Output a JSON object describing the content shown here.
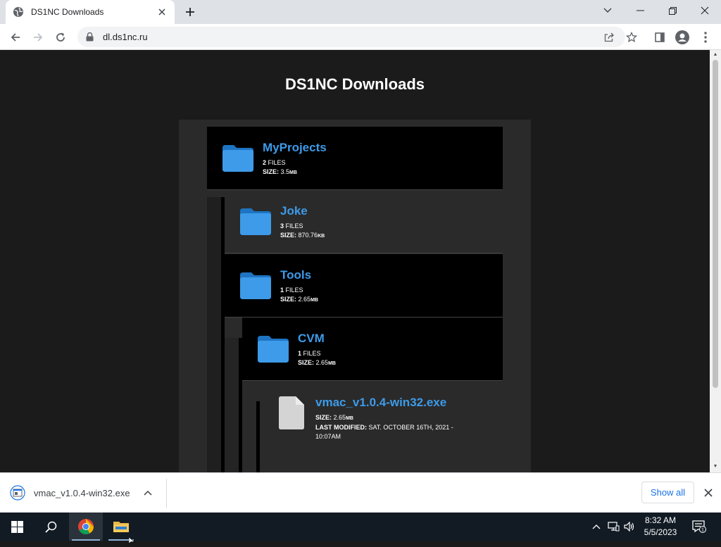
{
  "browser": {
    "tab_title": "DS1NC Downloads",
    "url": "dl.ds1nc.ru"
  },
  "page": {
    "heading": "DS1NC Downloads",
    "items": [
      {
        "type": "folder",
        "name": "MyProjects",
        "count": "2",
        "count_label": "FILES",
        "size_label": "SIZE:",
        "size_value": "3.5",
        "size_unit": "MB"
      },
      {
        "type": "folder",
        "name": "Joke",
        "count": "3",
        "count_label": "FILES",
        "size_label": "SIZE:",
        "size_value": "870.76",
        "size_unit": "KB"
      },
      {
        "type": "folder",
        "name": "Tools",
        "count": "1",
        "count_label": "FILES",
        "size_label": "SIZE:",
        "size_value": "2.65",
        "size_unit": "MB"
      },
      {
        "type": "folder",
        "name": "CVM",
        "count": "1",
        "count_label": "FILES",
        "size_label": "SIZE:",
        "size_value": "2.65",
        "size_unit": "MB"
      },
      {
        "type": "file",
        "name": "vmac_v1.0.4-win32.exe",
        "size_label": "SIZE:",
        "size_value": "2.65",
        "size_unit": "MB",
        "modified_label": "LAST MODIFIED:",
        "modified_value": "SAT. OCTOBER 16TH, 2021 -",
        "modified_value2": "10:07AM"
      }
    ]
  },
  "downloads": {
    "file_name": "vmac_v1.0.4-win32.exe",
    "show_all": "Show all"
  },
  "taskbar": {
    "time": "8:32 AM",
    "date": "5/5/2023",
    "notifications": "1"
  },
  "colors": {
    "link": "#3d9be9",
    "folder": "#2f8fe0",
    "page_bg": "#1b1b1b"
  }
}
